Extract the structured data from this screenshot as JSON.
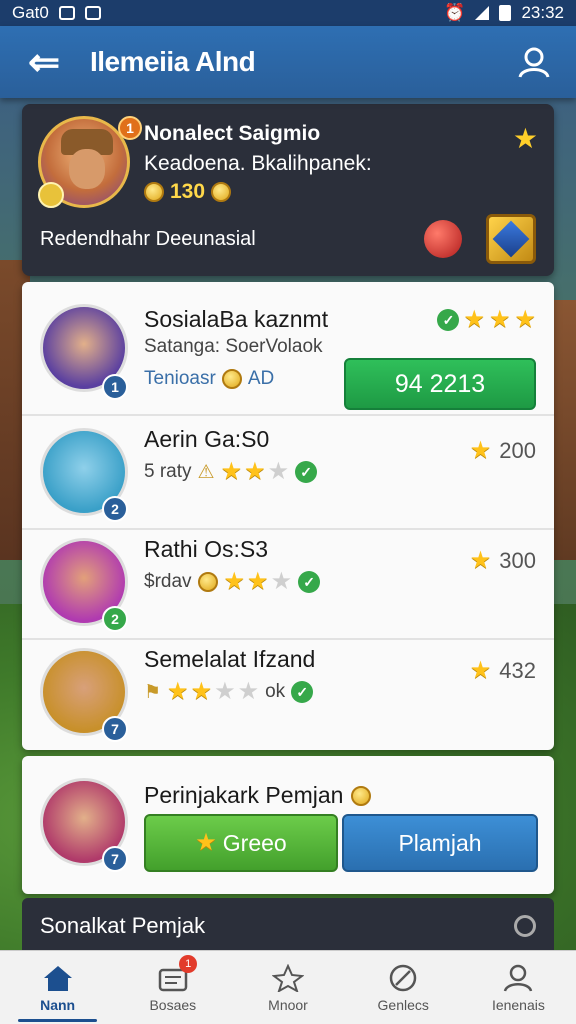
{
  "status_bar": {
    "carrier": "Gat0",
    "time": "23:32"
  },
  "app_bar": {
    "title": "Ilemeiia Alnd"
  },
  "header": {
    "name": "Nonalect Saigmio",
    "subtitle": "Keadoena. Bkalihpanek:",
    "coins": "130",
    "coin_prefix": "0",
    "level_badge": "1",
    "bottom_text": "Redendhahr Deeunasial"
  },
  "rows": [
    {
      "title": "SosialaBa kaznmt",
      "subtitle": "Satanga: SoerVolaok",
      "meta": "Tenioasr",
      "meta_tag": "AD",
      "badge": "1",
      "badge_color": "#2a5f9a",
      "stars": 3,
      "button": "94 2213",
      "avatar_color": "#5a3fa0"
    },
    {
      "title": "Aerin Ga:S0",
      "subtitle": "5 raty",
      "badge": "2",
      "badge_color": "#2a5f9a",
      "stars": 2,
      "score": "200",
      "avatar_color": "#3aa0c8"
    },
    {
      "title": "Rathi Os:S3",
      "subtitle": "$rdav",
      "badge": "2",
      "badge_color": "#36a84a",
      "stars": 2,
      "score": "300",
      "avatar_color": "#b03ab0"
    },
    {
      "title": "Semelalat Ifzand",
      "subtitle": "ok",
      "badge": "7",
      "badge_color": "#2a5f9a",
      "stars": 2,
      "score": "432",
      "avatar_color": "#c8902a"
    }
  ],
  "action": {
    "title": "Perinjakark Pemjan",
    "green_button": "Greeo",
    "blue_button": "Plamjah",
    "badge": "7"
  },
  "section": {
    "title": "Sonalkat Pemjak"
  },
  "nav": {
    "items": [
      {
        "label": "Nann"
      },
      {
        "label": "Bosaes",
        "badge": "1"
      },
      {
        "label": "Mnoor"
      },
      {
        "label": "Genlecs"
      },
      {
        "label": "Ienenais"
      }
    ]
  },
  "colors": {
    "accent": "#2a5f9a",
    "green": "#1e9a44",
    "gold": "#ffc21a"
  }
}
